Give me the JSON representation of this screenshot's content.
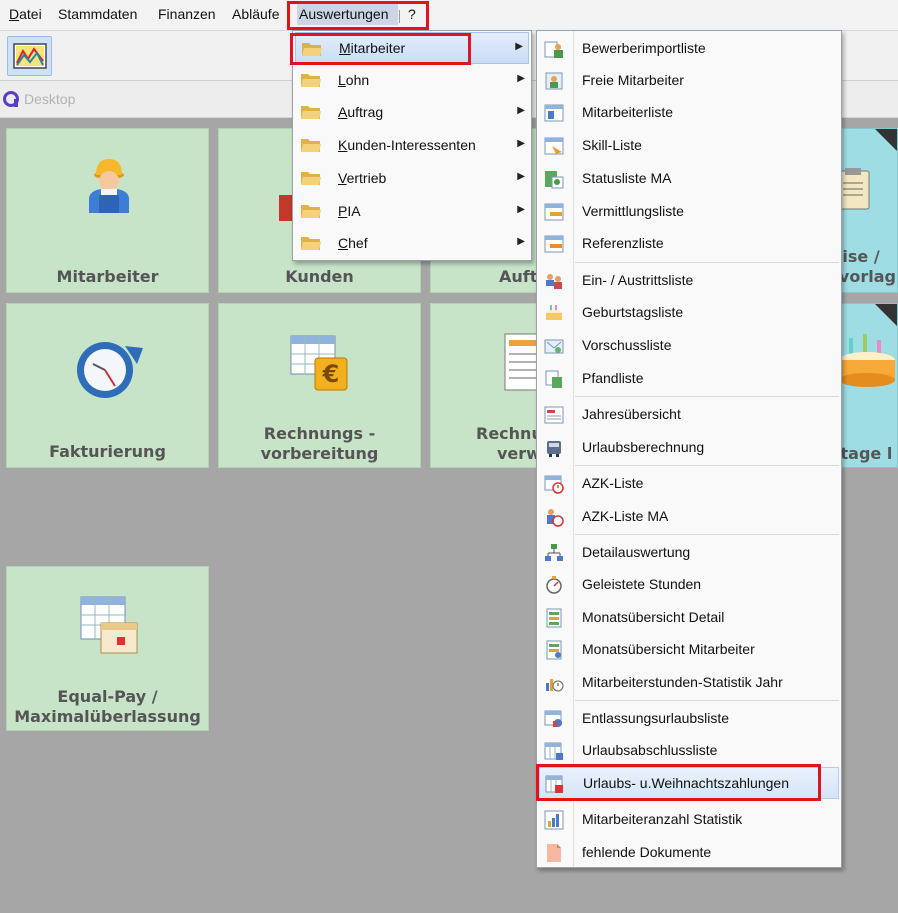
{
  "menubar": {
    "items": [
      {
        "mn": "D",
        "rest": "atei"
      },
      {
        "mn": "",
        "rest": "Stammdaten"
      },
      {
        "mn": "",
        "rest": "Finanzen"
      },
      {
        "mn": "",
        "rest": "Abläufe"
      },
      {
        "mn": "",
        "rest": "Auswertungen"
      },
      {
        "mn": "",
        "rest": "?"
      }
    ]
  },
  "desktop": {
    "title": "Desktop",
    "tiles": [
      {
        "label": "Mitarbeiter",
        "icon": "worker-icon"
      },
      {
        "label": "Kunden",
        "icon": "customers-icon"
      },
      {
        "label": "Auft",
        "icon": "orders-icon"
      },
      {
        "label": "uise /",
        "label2": "rvorlag",
        "icon": "clipboard-icon"
      },
      {
        "label": "Fakturierung",
        "icon": "clock-refresh-icon"
      },
      {
        "label": "Rechnungs -",
        "label2": "vorbereitung",
        "icon": "invoice-euro-icon"
      },
      {
        "label": "Rechnu",
        "label2": "verwa",
        "icon": "invoice-list-icon"
      },
      {
        "label": "stage l",
        "icon": "birthday-cake-icon"
      },
      {
        "label": "Equal-Pay /",
        "label2": "Maximalüberlassung",
        "icon": "calendar-table-icon"
      }
    ]
  },
  "menu_auswertungen": {
    "items": [
      {
        "mn": "M",
        "rest": "itarbeiter"
      },
      {
        "mn": "L",
        "rest": "ohn"
      },
      {
        "mn": "A",
        "rest": "uftrag"
      },
      {
        "mn": "K",
        "rest": "unden-Interessenten"
      },
      {
        "mn": "V",
        "rest": "ertrieb"
      },
      {
        "mn": "P",
        "rest": "IA"
      },
      {
        "mn": "C",
        "rest": "hef"
      }
    ]
  },
  "menu_mitarbeiter": {
    "groups": [
      [
        "Bewerberimportliste",
        "Freie Mitarbeiter",
        "Mitarbeiterliste",
        "Skill-Liste",
        "Statusliste MA",
        "Vermittlungsliste",
        "Referenzliste"
      ],
      [
        "Ein- / Austrittsliste",
        "Geburtstagsliste",
        "Vorschussliste",
        "Pfandliste"
      ],
      [
        "Jahresübersicht",
        "Urlaubsberechnung"
      ],
      [
        "AZK-Liste",
        "AZK-Liste MA"
      ],
      [
        "Detailauswertung",
        "Geleistete Stunden",
        "Monatsübersicht Detail",
        "Monatsübersicht Mitarbeiter",
        "Mitarbeiterstunden-Statistik Jahr"
      ],
      [
        "Entlassungsurlaubsliste",
        "Urlaubsabschlussliste",
        "Urlaubs- u.Weihnachtszahlungen",
        "Mitarbeiteranzahl Statistik",
        "fehlende Dokumente"
      ]
    ]
  },
  "colors": {
    "highlight_red": "#e1141e",
    "tile_green": "#c8e4c8",
    "tile_blue": "#9fdde4"
  }
}
